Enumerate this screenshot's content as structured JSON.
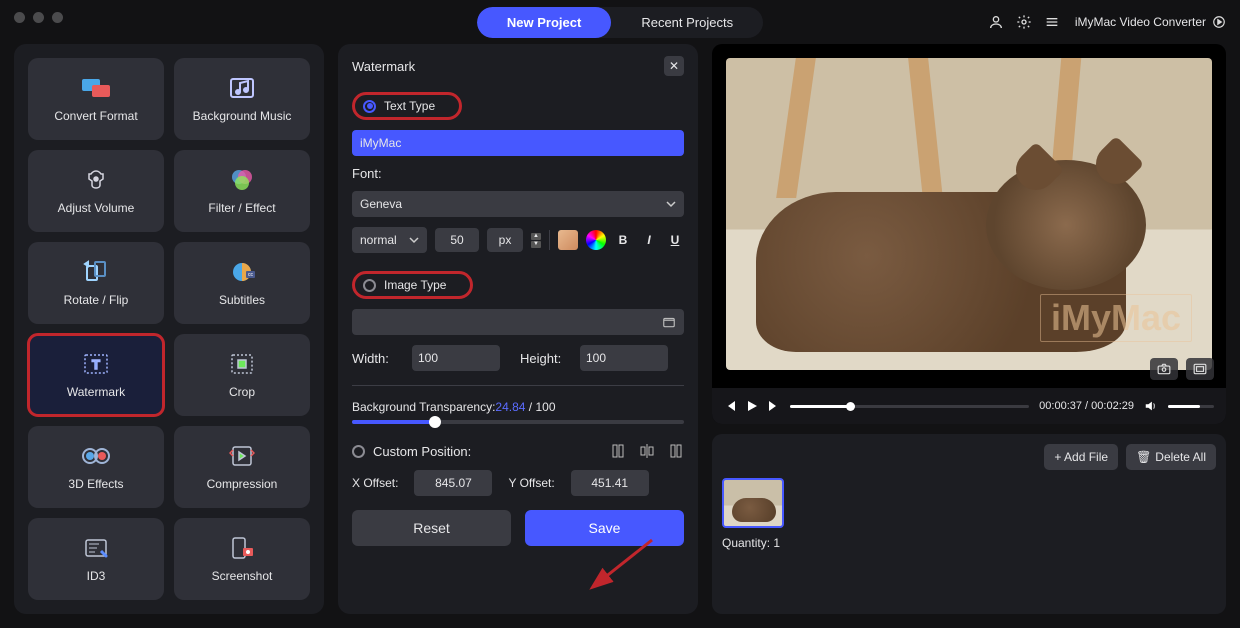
{
  "app": {
    "name": "iMyMac Video Converter"
  },
  "topnav": {
    "new_project": "New Project",
    "recent_projects": "Recent Projects"
  },
  "tools": [
    {
      "id": "convert-format",
      "label": "Convert Format"
    },
    {
      "id": "background-music",
      "label": "Background Music"
    },
    {
      "id": "adjust-volume",
      "label": "Adjust Volume"
    },
    {
      "id": "filter-effect",
      "label": "Filter / Effect"
    },
    {
      "id": "rotate-flip",
      "label": "Rotate / Flip"
    },
    {
      "id": "subtitles",
      "label": "Subtitles"
    },
    {
      "id": "watermark",
      "label": "Watermark"
    },
    {
      "id": "crop",
      "label": "Crop"
    },
    {
      "id": "3d-effects",
      "label": "3D Effects"
    },
    {
      "id": "compression",
      "label": "Compression"
    },
    {
      "id": "id3",
      "label": "ID3"
    },
    {
      "id": "screenshot",
      "label": "Screenshot"
    }
  ],
  "watermark_panel": {
    "title": "Watermark",
    "text_type_label": "Text Type",
    "text_value": "iMyMac",
    "font_label": "Font:",
    "font_family": "Geneva",
    "font_style": "normal",
    "font_size": "50",
    "font_unit": "px",
    "bold": "B",
    "italic": "I",
    "underline": "U",
    "image_type_label": "Image Type",
    "width_label": "Width:",
    "width_value": "100",
    "height_label": "Height:",
    "height_value": "100",
    "transparency_label": "Background Transparency:",
    "transparency_value": "24.84",
    "transparency_max": "100",
    "custom_position_label": "Custom Position:",
    "x_offset_label": "X Offset:",
    "x_offset_value": "845.07",
    "y_offset_label": "Y Offset:",
    "y_offset_value": "451.41",
    "reset": "Reset",
    "save": "Save"
  },
  "player": {
    "current_time": "00:00:37",
    "total_time": "00:02:29",
    "watermark_preview_text": "iMyMac"
  },
  "files": {
    "add_file": "+ Add File",
    "delete_all_icon": "🗑",
    "delete_all": "Delete All",
    "quantity_label": "Quantity:",
    "quantity_value": "1"
  }
}
